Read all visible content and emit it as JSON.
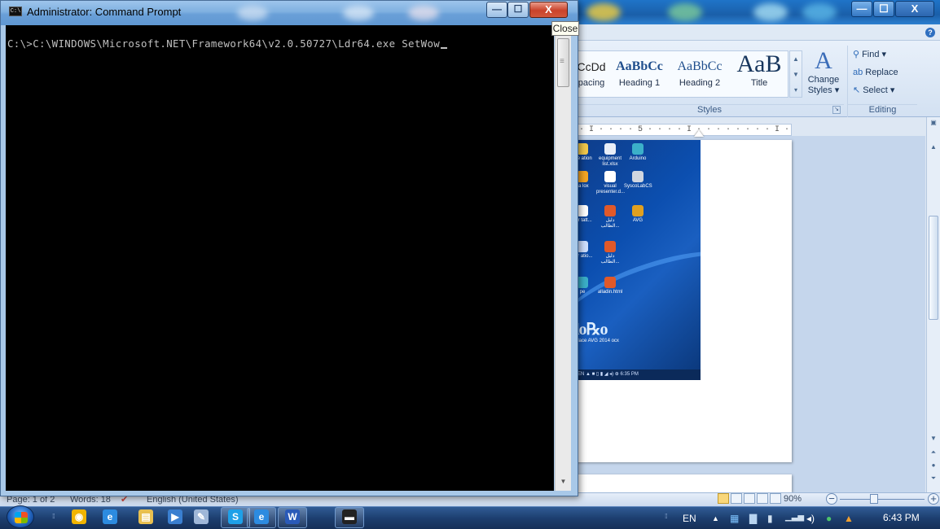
{
  "cmd": {
    "title": "Administrator: Command Prompt",
    "icon_label": "C:\\",
    "console_line": "C:\\>C:\\WINDOWS\\Microsoft.NET\\Framework64\\v2.0.50727\\Ldr64.exe SetWow",
    "close_tooltip": "Close",
    "buttons": {
      "minimize": "—",
      "maximize": "☐",
      "close": "X"
    },
    "icons": {
      "minimize": "minimize-icon",
      "maximize": "maximize-icon",
      "close": "close-icon"
    }
  },
  "word": {
    "window_buttons": {
      "minimize": "—",
      "maximize": "☐",
      "close": "X"
    },
    "styles": [
      {
        "sample": "CcDd",
        "label": "pacing"
      },
      {
        "sample": "AaBbCc",
        "label": "Heading 1"
      },
      {
        "sample": "AaBbCc",
        "label": "Heading 2"
      },
      {
        "sample": "AaB",
        "label": "Title"
      }
    ],
    "change_styles": {
      "glyph": "A",
      "label": "Change Styles ▾"
    },
    "styles_group_label": "Styles",
    "editing": {
      "find": "Find ▾",
      "replace": "Replace",
      "select": "Select ▾",
      "group_label": "Editing"
    },
    "ruler_text": "· I · · · · 5 · · · · I · · · ·   · · · · I · · · · 7 ·",
    "status": {
      "page": "Page: 1 of 2",
      "words": "Words: 18",
      "language": "English (United States)"
    },
    "zoom": "90%",
    "zoom_fraction": 0.4
  },
  "embedded_desktop": {
    "icons": [
      {
        "label": "are ation",
        "color": "#f2c94c"
      },
      {
        "label": "equipment list.xlsx",
        "color": "#e8eef8"
      },
      {
        "label": "Arduino",
        "color": "#3bb0c9"
      },
      {
        "label": "lla lox",
        "color": "#f5a623"
      },
      {
        "label": "visual presenter.d...",
        "color": "#ffffff"
      },
      {
        "label": "SyscoLabCS",
        "color": "#d0d6e0"
      },
      {
        "label": "ker tatt...",
        "color": "#ffffff"
      },
      {
        "label": "دليل الطالب...",
        "color": "#e0592a"
      },
      {
        "label": "AVG",
        "color": "#e0a020"
      },
      {
        "label": "per atio...",
        "color": "#cfe0ff"
      },
      {
        "label": "دليل الطالب...",
        "color": "#e0592a"
      },
      {
        "label": "pe",
        "color": "#3bb0c9"
      },
      {
        "label": "alladin.html",
        "color": "#e0592a"
      }
    ],
    "brand": "lo℞o",
    "brand_caption": "place AVG 2014 ocx",
    "taskbar_text": "EN ▲ ■ ▯ ▮ ◢ ◂) ⊕ 6:35 PM"
  },
  "taskbar": {
    "pinned": [
      {
        "name": "chrome-icon",
        "glyph": "◉",
        "color": "#f0b400"
      },
      {
        "name": "internet-explorer-icon",
        "glyph": "e",
        "color": "#2c8be0"
      },
      {
        "name": "file-explorer-icon",
        "glyph": "▤",
        "color": "#e8c050"
      },
      {
        "name": "media-player-icon",
        "glyph": "▶",
        "color": "#3a7fd0"
      },
      {
        "name": "tool-icon",
        "glyph": "✎",
        "color": "#9fb7d8"
      },
      {
        "name": "skype-icon",
        "glyph": "S",
        "color": "#1ea0e8"
      },
      {
        "name": "internet-explorer-2-icon",
        "glyph": "e",
        "color": "#2c8be0"
      },
      {
        "name": "word-icon",
        "glyph": "W",
        "color": "#2a5ab8"
      },
      {
        "name": "cmd-icon",
        "glyph": "▬",
        "color": "#222222"
      }
    ],
    "language": "EN",
    "tray_chevron": "▲",
    "clock": "6:43 PM"
  }
}
